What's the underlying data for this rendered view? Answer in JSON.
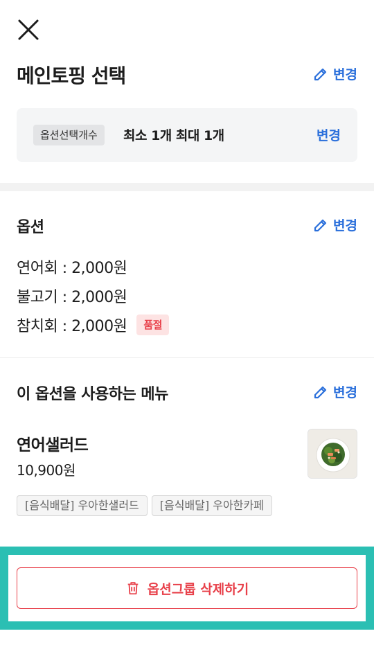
{
  "header": {
    "close_icon": "close-icon"
  },
  "group": {
    "title": "메인토핑 선택",
    "edit_label": "변경",
    "count": {
      "chip_label": "옵션선택개수",
      "text": "최소 1개 최대 1개",
      "change_label": "변경"
    }
  },
  "options": {
    "title": "옵션",
    "edit_label": "변경",
    "items": [
      {
        "text": "연어회 : 2,000원"
      },
      {
        "text": "불고기 : 2,000원"
      },
      {
        "text": "참치회 : 2,000원",
        "badge": "품절"
      }
    ]
  },
  "menus": {
    "title": "이 옵션을 사용하는 메뉴",
    "edit_label": "변경",
    "items": [
      {
        "name": "연어샐러드",
        "price": "10,900원",
        "shops": [
          "[음식배달] 우아한샐러드",
          "[음식배달] 우아한카페"
        ]
      }
    ]
  },
  "footer": {
    "delete_label": "옵션그룹 삭제하기"
  },
  "colors": {
    "accent": "#2a6fdb",
    "danger": "#e8404a",
    "highlight": "#2bbfb3"
  }
}
